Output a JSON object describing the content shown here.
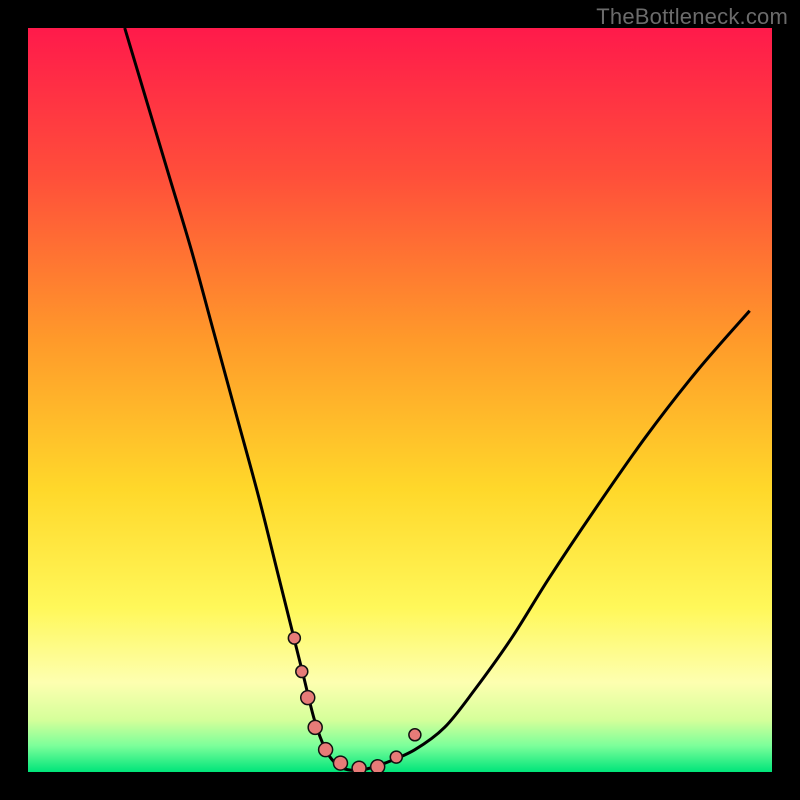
{
  "attribution": "TheBottleneck.com",
  "chart_data": {
    "type": "line",
    "title": "",
    "xlabel": "",
    "ylabel": "",
    "xlim": [
      0,
      100
    ],
    "ylim": [
      0,
      100
    ],
    "series": [
      {
        "name": "curve",
        "x": [
          13,
          16,
          19,
          22,
          25,
          28,
          31,
          33.5,
          35.5,
          37,
          38.5,
          40,
          41.5,
          43,
          45,
          48,
          52,
          56,
          60,
          65,
          70,
          76,
          83,
          90,
          97
        ],
        "y": [
          100,
          90,
          80,
          70,
          59,
          48,
          37,
          27,
          19,
          13,
          7,
          3,
          1,
          0.3,
          0.3,
          1.2,
          3,
          6,
          11,
          18,
          26,
          35,
          45,
          54,
          62
        ]
      }
    ],
    "markers": [
      {
        "name": "marker-a",
        "x": 35.8,
        "y": 18,
        "r": 6
      },
      {
        "name": "marker-b",
        "x": 36.8,
        "y": 13.5,
        "r": 6
      },
      {
        "name": "marker-c",
        "x": 37.6,
        "y": 10,
        "r": 7
      },
      {
        "name": "marker-d",
        "x": 38.6,
        "y": 6,
        "r": 7
      },
      {
        "name": "marker-e",
        "x": 40.0,
        "y": 3,
        "r": 7
      },
      {
        "name": "marker-f",
        "x": 42.0,
        "y": 1.2,
        "r": 7
      },
      {
        "name": "marker-g",
        "x": 44.5,
        "y": 0.5,
        "r": 7
      },
      {
        "name": "marker-h",
        "x": 47.0,
        "y": 0.7,
        "r": 7
      },
      {
        "name": "marker-i",
        "x": 49.5,
        "y": 2.0,
        "r": 6
      },
      {
        "name": "marker-j",
        "x": 52.0,
        "y": 5.0,
        "r": 6
      }
    ],
    "gradient_stops": [
      {
        "offset": 0.0,
        "color": "#ff1a4b"
      },
      {
        "offset": 0.2,
        "color": "#ff4f3a"
      },
      {
        "offset": 0.42,
        "color": "#ff9a2a"
      },
      {
        "offset": 0.62,
        "color": "#ffd82a"
      },
      {
        "offset": 0.78,
        "color": "#fff85a"
      },
      {
        "offset": 0.88,
        "color": "#fdffb0"
      },
      {
        "offset": 0.93,
        "color": "#d5ff9a"
      },
      {
        "offset": 0.965,
        "color": "#7bff9a"
      },
      {
        "offset": 1.0,
        "color": "#00e57a"
      }
    ],
    "colors": {
      "curve": "#000000",
      "marker_fill": "#e77b78",
      "marker_stroke": "#111111",
      "frame": "#000000"
    }
  }
}
